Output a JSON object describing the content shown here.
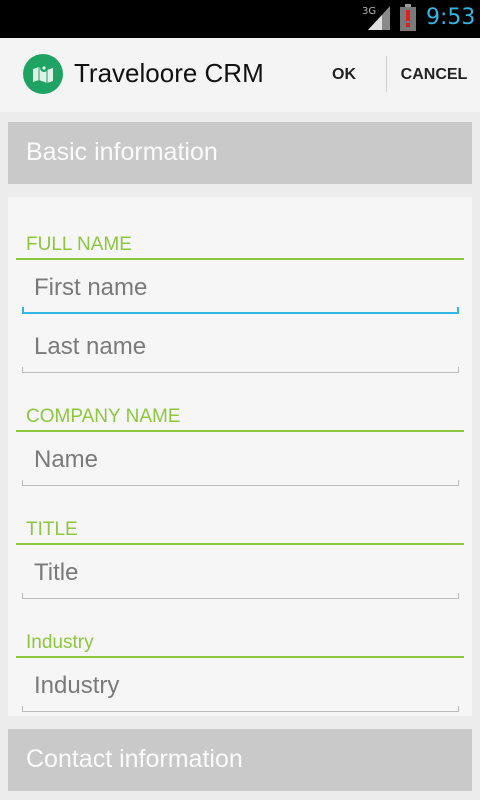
{
  "status_bar": {
    "network": "3G",
    "time": "9:53",
    "signal_icon": "signal-strength-icon",
    "battery_icon": "battery-alert-icon"
  },
  "action_bar": {
    "app_icon": "map-pin-icon",
    "title": "Traveloore CRM",
    "ok_label": "OK",
    "cancel_label": "CANCEL"
  },
  "sections": {
    "basic": "Basic information",
    "contact": "Contact information"
  },
  "form": {
    "full_name_label": "FULL NAME",
    "first_name": {
      "value": "",
      "placeholder": "First name"
    },
    "last_name": {
      "value": "",
      "placeholder": "Last name"
    },
    "company_label": "COMPANY NAME",
    "company": {
      "value": "",
      "placeholder": "Name"
    },
    "title_label": "TITLE",
    "title": {
      "value": "",
      "placeholder": "Title"
    },
    "industry_label": "Industry",
    "industry": {
      "value": "",
      "placeholder": "Industry"
    }
  },
  "colors": {
    "accent_green": "#8dc63f",
    "focus_blue": "#33b5e5",
    "section_gray": "#c9c9c9"
  }
}
